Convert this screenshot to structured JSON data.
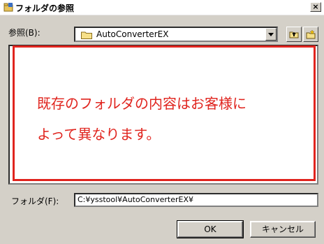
{
  "window": {
    "title": "フォルダの参照",
    "close_label": "×"
  },
  "lookin": {
    "label": "参照(B):",
    "value": "AutoConverterEX",
    "dropdown_icon": "chevron-down-icon"
  },
  "notice": {
    "line1": "既存のフォルダの内容はお客様に",
    "line2": "よって異なります。"
  },
  "folder": {
    "label": "フォルダ(F):",
    "value": "C:¥ysstool¥AutoConverterEX¥"
  },
  "buttons": {
    "ok": "OK",
    "cancel": "キャンセル"
  },
  "colors": {
    "accent": "#e0241e",
    "dialog_bg": "#d4d0c8"
  }
}
